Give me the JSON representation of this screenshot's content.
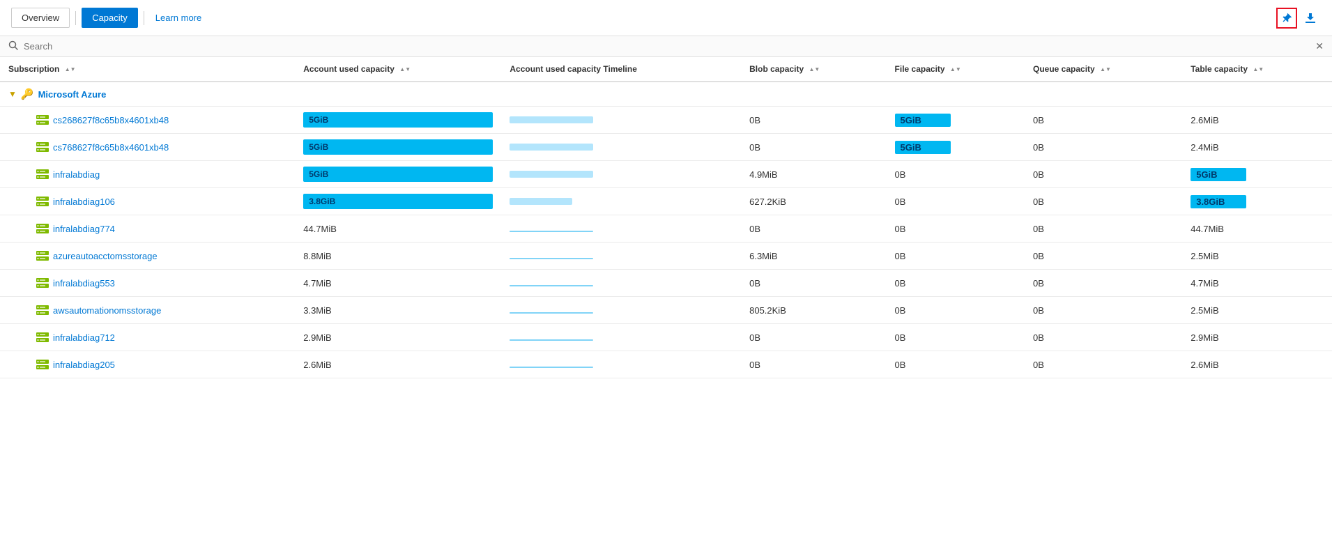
{
  "nav": {
    "overview_label": "Overview",
    "capacity_label": "Capacity",
    "learn_more_label": "Learn more"
  },
  "toolbar": {
    "pin_icon": "📌",
    "download_icon": "⬇"
  },
  "search": {
    "placeholder": "Search",
    "clear_icon": "✕"
  },
  "table": {
    "columns": [
      {
        "key": "subscription",
        "label": "Subscription",
        "sortable": true
      },
      {
        "key": "account_used_capacity",
        "label": "Account used capacity",
        "sortable": true
      },
      {
        "key": "account_used_capacity_timeline",
        "label": "Account used capacity Timeline",
        "sortable": false
      },
      {
        "key": "blob_capacity",
        "label": "Blob capacity",
        "sortable": true
      },
      {
        "key": "file_capacity",
        "label": "File capacity",
        "sortable": true
      },
      {
        "key": "queue_capacity",
        "label": "Queue capacity",
        "sortable": true
      },
      {
        "key": "table_capacity",
        "label": "Table capacity",
        "sortable": true
      }
    ],
    "group": {
      "name": "Microsoft Azure",
      "icon": "🔑"
    },
    "rows": [
      {
        "subscription": "cs268627f8c65b8x4601xb48",
        "account_used_capacity": "5GiB",
        "account_used_capacity_bar": "full",
        "blob_capacity": "0B",
        "file_capacity": "5GiB",
        "file_capacity_highlight": true,
        "queue_capacity": "0B",
        "table_capacity": "2.6MiB",
        "table_capacity_highlight": false
      },
      {
        "subscription": "cs768627f8c65b8x4601xb48",
        "account_used_capacity": "5GiB",
        "account_used_capacity_bar": "full",
        "blob_capacity": "0B",
        "file_capacity": "5GiB",
        "file_capacity_highlight": true,
        "queue_capacity": "0B",
        "table_capacity": "2.4MiB",
        "table_capacity_highlight": false
      },
      {
        "subscription": "infralabdiag",
        "account_used_capacity": "5GiB",
        "account_used_capacity_bar": "full",
        "blob_capacity": "4.9MiB",
        "file_capacity": "0B",
        "file_capacity_highlight": false,
        "queue_capacity": "0B",
        "table_capacity": "5GiB",
        "table_capacity_highlight": true
      },
      {
        "subscription": "infralabdiag106",
        "account_used_capacity": "3.8GiB",
        "account_used_capacity_bar": "smaller",
        "blob_capacity": "627.2KiB",
        "file_capacity": "0B",
        "file_capacity_highlight": false,
        "queue_capacity": "0B",
        "table_capacity": "3.8GiB",
        "table_capacity_highlight": true
      },
      {
        "subscription": "infralabdiag774",
        "account_used_capacity": "44.7MiB",
        "account_used_capacity_bar": "none",
        "blob_capacity": "0B",
        "file_capacity": "0B",
        "file_capacity_highlight": false,
        "queue_capacity": "0B",
        "table_capacity": "44.7MiB",
        "table_capacity_highlight": false
      },
      {
        "subscription": "azureautoacctomsstorage",
        "account_used_capacity": "8.8MiB",
        "account_used_capacity_bar": "none",
        "blob_capacity": "6.3MiB",
        "file_capacity": "0B",
        "file_capacity_highlight": false,
        "queue_capacity": "0B",
        "table_capacity": "2.5MiB",
        "table_capacity_highlight": false
      },
      {
        "subscription": "infralabdiag553",
        "account_used_capacity": "4.7MiB",
        "account_used_capacity_bar": "none",
        "blob_capacity": "0B",
        "file_capacity": "0B",
        "file_capacity_highlight": false,
        "queue_capacity": "0B",
        "table_capacity": "4.7MiB",
        "table_capacity_highlight": false
      },
      {
        "subscription": "awsautomationomsstorage",
        "account_used_capacity": "3.3MiB",
        "account_used_capacity_bar": "none",
        "blob_capacity": "805.2KiB",
        "file_capacity": "0B",
        "file_capacity_highlight": false,
        "queue_capacity": "0B",
        "table_capacity": "2.5MiB",
        "table_capacity_highlight": false
      },
      {
        "subscription": "infralabdiag712",
        "account_used_capacity": "2.9MiB",
        "account_used_capacity_bar": "none",
        "blob_capacity": "0B",
        "file_capacity": "0B",
        "file_capacity_highlight": false,
        "queue_capacity": "0B",
        "table_capacity": "2.9MiB",
        "table_capacity_highlight": false
      },
      {
        "subscription": "infralabdiag205",
        "account_used_capacity": "2.6MiB",
        "account_used_capacity_bar": "none",
        "blob_capacity": "0B",
        "file_capacity": "0B",
        "file_capacity_highlight": false,
        "queue_capacity": "0B",
        "table_capacity": "2.6MiB",
        "table_capacity_highlight": false
      }
    ]
  }
}
